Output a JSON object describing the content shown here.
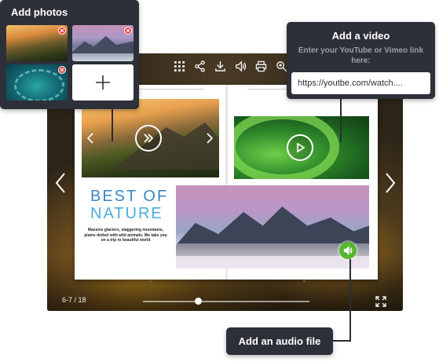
{
  "photos_panel": {
    "title": "Add photos",
    "thumbnails": [
      "sunset-mountains-icon",
      "snowy-peaks-icon",
      "peacock-icon"
    ],
    "add_label": "+"
  },
  "video_panel": {
    "title": "Add a video",
    "description": "Enter your YouTube or Vimeo link here:",
    "url_value": "https://youtbe.com/watch...."
  },
  "audio_panel": {
    "label": "Add an audio file"
  },
  "viewer": {
    "toolbar_icons": [
      "grid-icon",
      "share-icon",
      "download-icon",
      "sound-icon",
      "print-icon",
      "zoom-icon"
    ],
    "page_counter": "6-7 / 18",
    "progress_fraction": 0.33
  },
  "book": {
    "title_line1": "BEST OF",
    "title_line2": "NATURE",
    "caption": "Massive glaciers, staggering mountains, plains dotted with wild animals. We take you on a trip to beautiful world"
  },
  "colors": {
    "panel_bg": "#2d3038",
    "accent_blue": "#3a9ad1",
    "audio_green": "#56b72f",
    "remove_red": "#e8393a"
  }
}
